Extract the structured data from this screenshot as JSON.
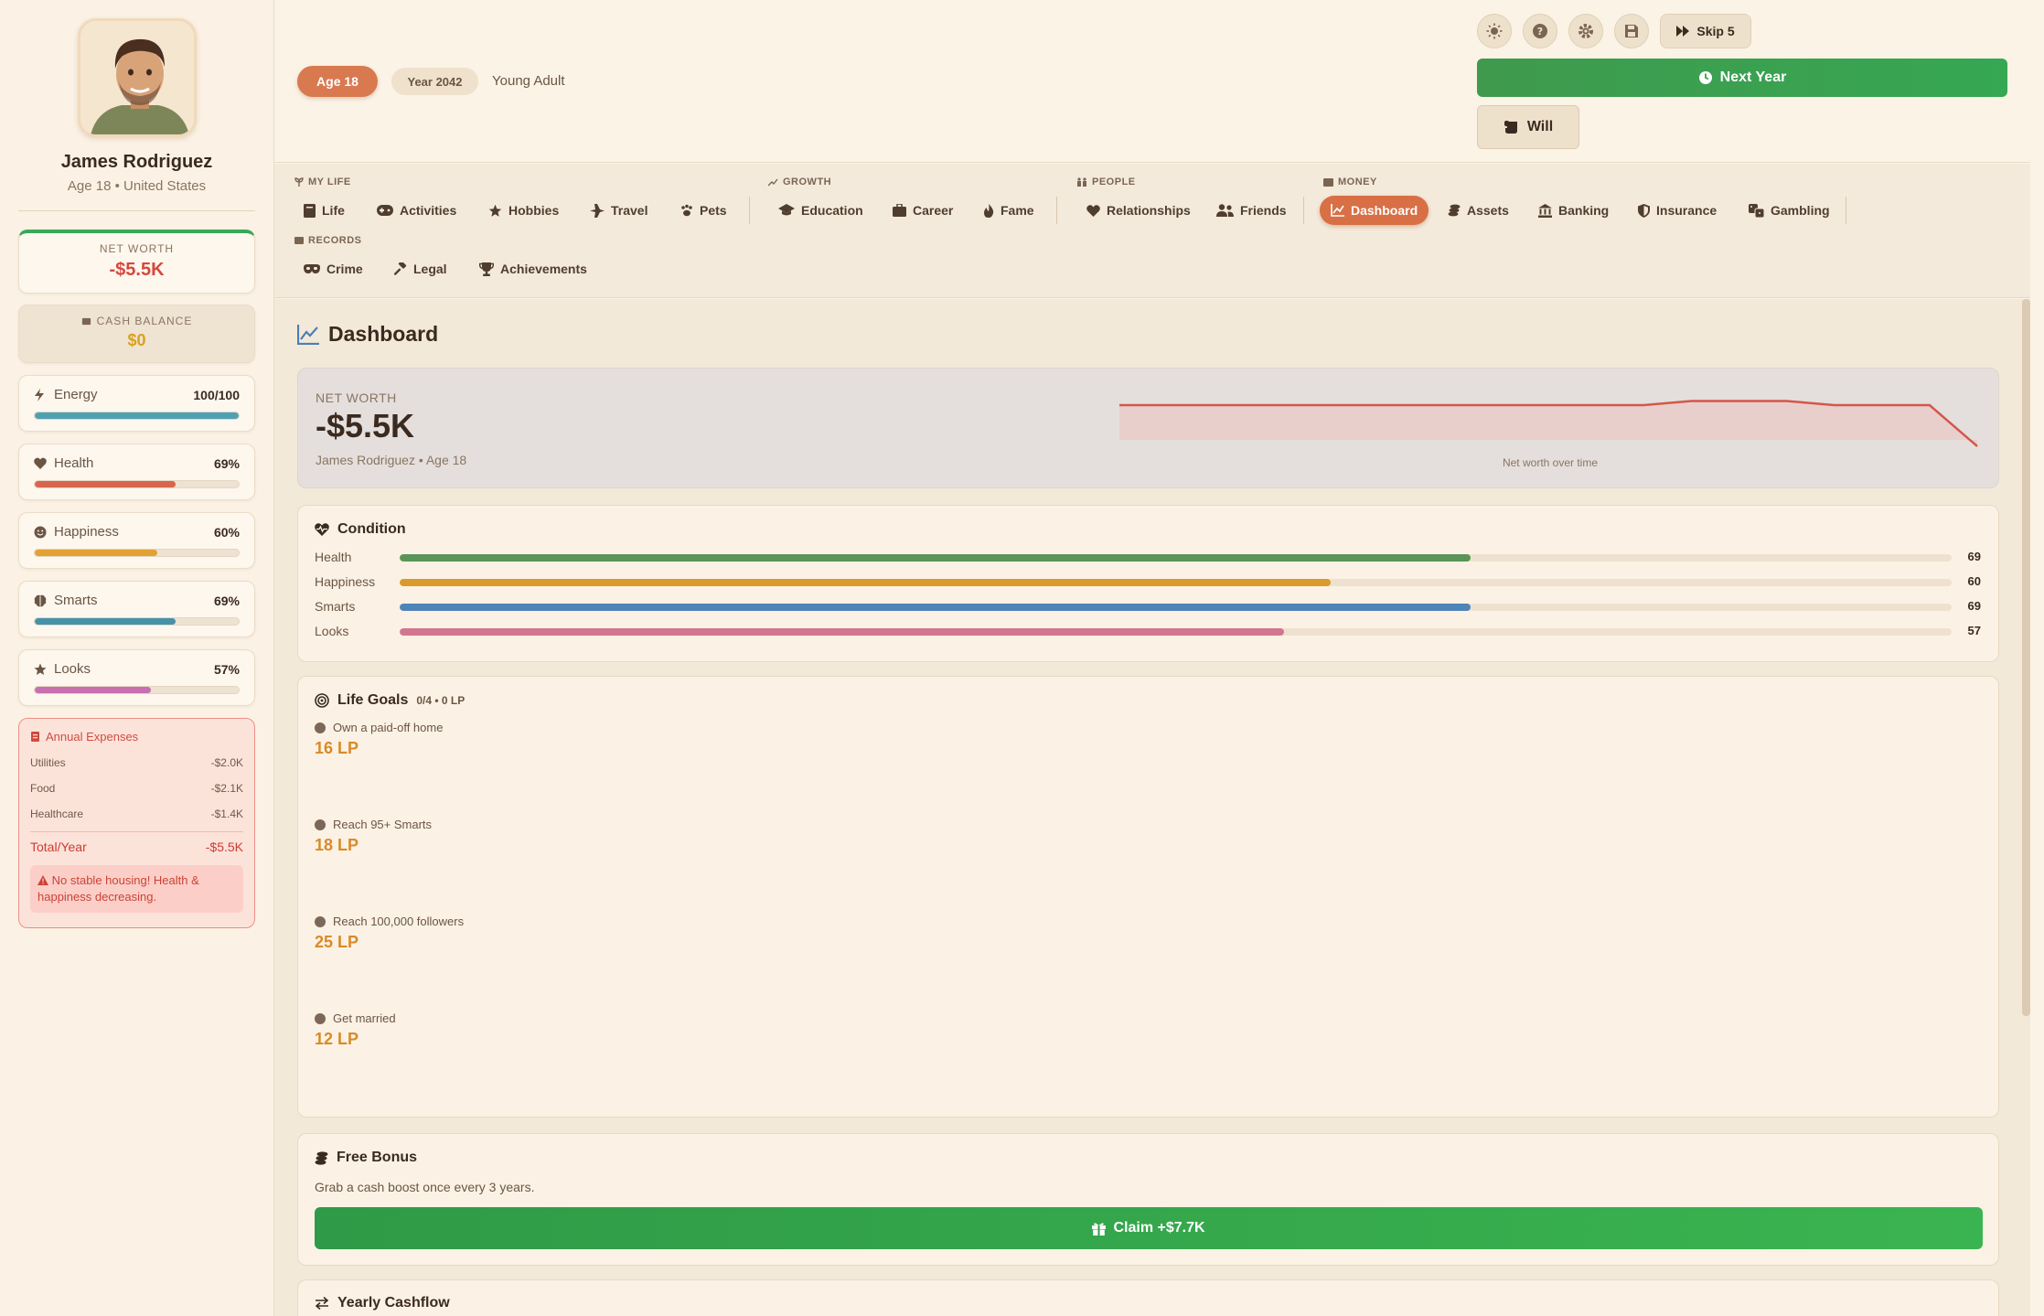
{
  "player": {
    "name": "James Rodriguez",
    "subtitle": "Age 18 • United States"
  },
  "sidebar": {
    "net_worth_label": "NET WORTH",
    "net_worth_value": "-$5.5K",
    "cash_label": "CASH BALANCE",
    "cash_value": "$0",
    "stats": [
      {
        "name": "Energy",
        "value": "100/100",
        "level": 1.0,
        "color": "#4ea1b3",
        "icon": "bolt-icon"
      },
      {
        "name": "Health",
        "value": "69%",
        "level": 0.69,
        "color": "#d9654c",
        "icon": "heart-icon"
      },
      {
        "name": "Happiness",
        "value": "60%",
        "level": 0.6,
        "color": "#e2a232",
        "icon": "smile-icon"
      },
      {
        "name": "Smarts",
        "value": "69%",
        "level": 0.69,
        "color": "#4592a8",
        "icon": "brain-icon"
      },
      {
        "name": "Looks",
        "value": "57%",
        "level": 0.57,
        "color": "#c86fb1",
        "icon": "star-icon"
      }
    ],
    "expenses": {
      "title": "Annual Expenses",
      "items": [
        {
          "label": "Utilities",
          "value": "-$2.0K"
        },
        {
          "label": "Food",
          "value": "-$2.1K"
        },
        {
          "label": "Healthcare",
          "value": "-$1.4K"
        }
      ],
      "total_label": "Total/Year",
      "total_value": "-$5.5K",
      "warning": "No stable housing! Health & happiness decreasing."
    }
  },
  "topbar": {
    "age_pill": "Age 18",
    "year_pill": "Year 2042",
    "life_stage": "Young Adult",
    "skip_label": "Skip 5",
    "next_year_label": "Next Year",
    "will_label": "Will",
    "icon_buttons": [
      "sun-icon",
      "help-icon",
      "settings-icon",
      "save-icon"
    ]
  },
  "nav": {
    "groups": {
      "my_life": "MY LIFE",
      "growth": "GROWTH",
      "people": "PEOPLE",
      "money": "MONEY",
      "records": "RECORDS"
    },
    "items": {
      "life": "Life",
      "activities": "Activities",
      "hobbies": "Hobbies",
      "travel": "Travel",
      "pets": "Pets",
      "education": "Education",
      "career": "Career",
      "fame": "Fame",
      "relationships": "Relationships",
      "friends": "Friends",
      "dashboard": "Dashboard",
      "assets": "Assets",
      "banking": "Banking",
      "insurance": "Insurance",
      "gambling": "Gambling",
      "crime": "Crime",
      "legal": "Legal",
      "achievements": "Achievements"
    }
  },
  "dashboard": {
    "title": "Dashboard",
    "net_worth": {
      "label": "NET WORTH",
      "value": "-$5.5K",
      "subtitle": "James Rodriguez • Age 18",
      "chart_caption": "Net worth over time",
      "line_color": "#d4574a"
    },
    "condition": {
      "title": "Condition",
      "rows": [
        {
          "name": "Health",
          "value": 69,
          "color": "#5a9456"
        },
        {
          "name": "Happiness",
          "value": 60,
          "color": "#d99b2b"
        },
        {
          "name": "Smarts",
          "value": 69,
          "color": "#4f84b8"
        },
        {
          "name": "Looks",
          "value": 57,
          "color": "#d2768f"
        }
      ]
    },
    "life_goals": {
      "title": "Life Goals",
      "progress": "0/4 • 0 LP",
      "goals": [
        {
          "name": "Own a paid-off home",
          "lp": "16 LP"
        },
        {
          "name": "Reach 95+ Smarts",
          "lp": "18 LP"
        },
        {
          "name": "Reach 100,000 followers",
          "lp": "25 LP"
        },
        {
          "name": "Get married",
          "lp": "12 LP"
        }
      ]
    },
    "free_bonus": {
      "title": "Free Bonus",
      "description": "Grab a cash boost once every 3 years.",
      "claim_label": "Claim +$7.7K"
    },
    "cashflow": {
      "title": "Yearly Cashflow"
    }
  },
  "chart_data": {
    "type": "area",
    "x": [
      0,
      1,
      2,
      3,
      4,
      5,
      6,
      7,
      8,
      9,
      10,
      11,
      12,
      13,
      14,
      15,
      16,
      17,
      18
    ],
    "y": [
      0.8,
      0.8,
      0.8,
      0.8,
      0.8,
      0.8,
      0.8,
      0.8,
      0.8,
      0.8,
      0.8,
      0.8,
      0.86,
      0.86,
      0.86,
      0.8,
      0.8,
      0.8,
      0.2
    ],
    "xlabel": "",
    "ylabel": "",
    "title": "",
    "caption": "Net worth over time"
  }
}
